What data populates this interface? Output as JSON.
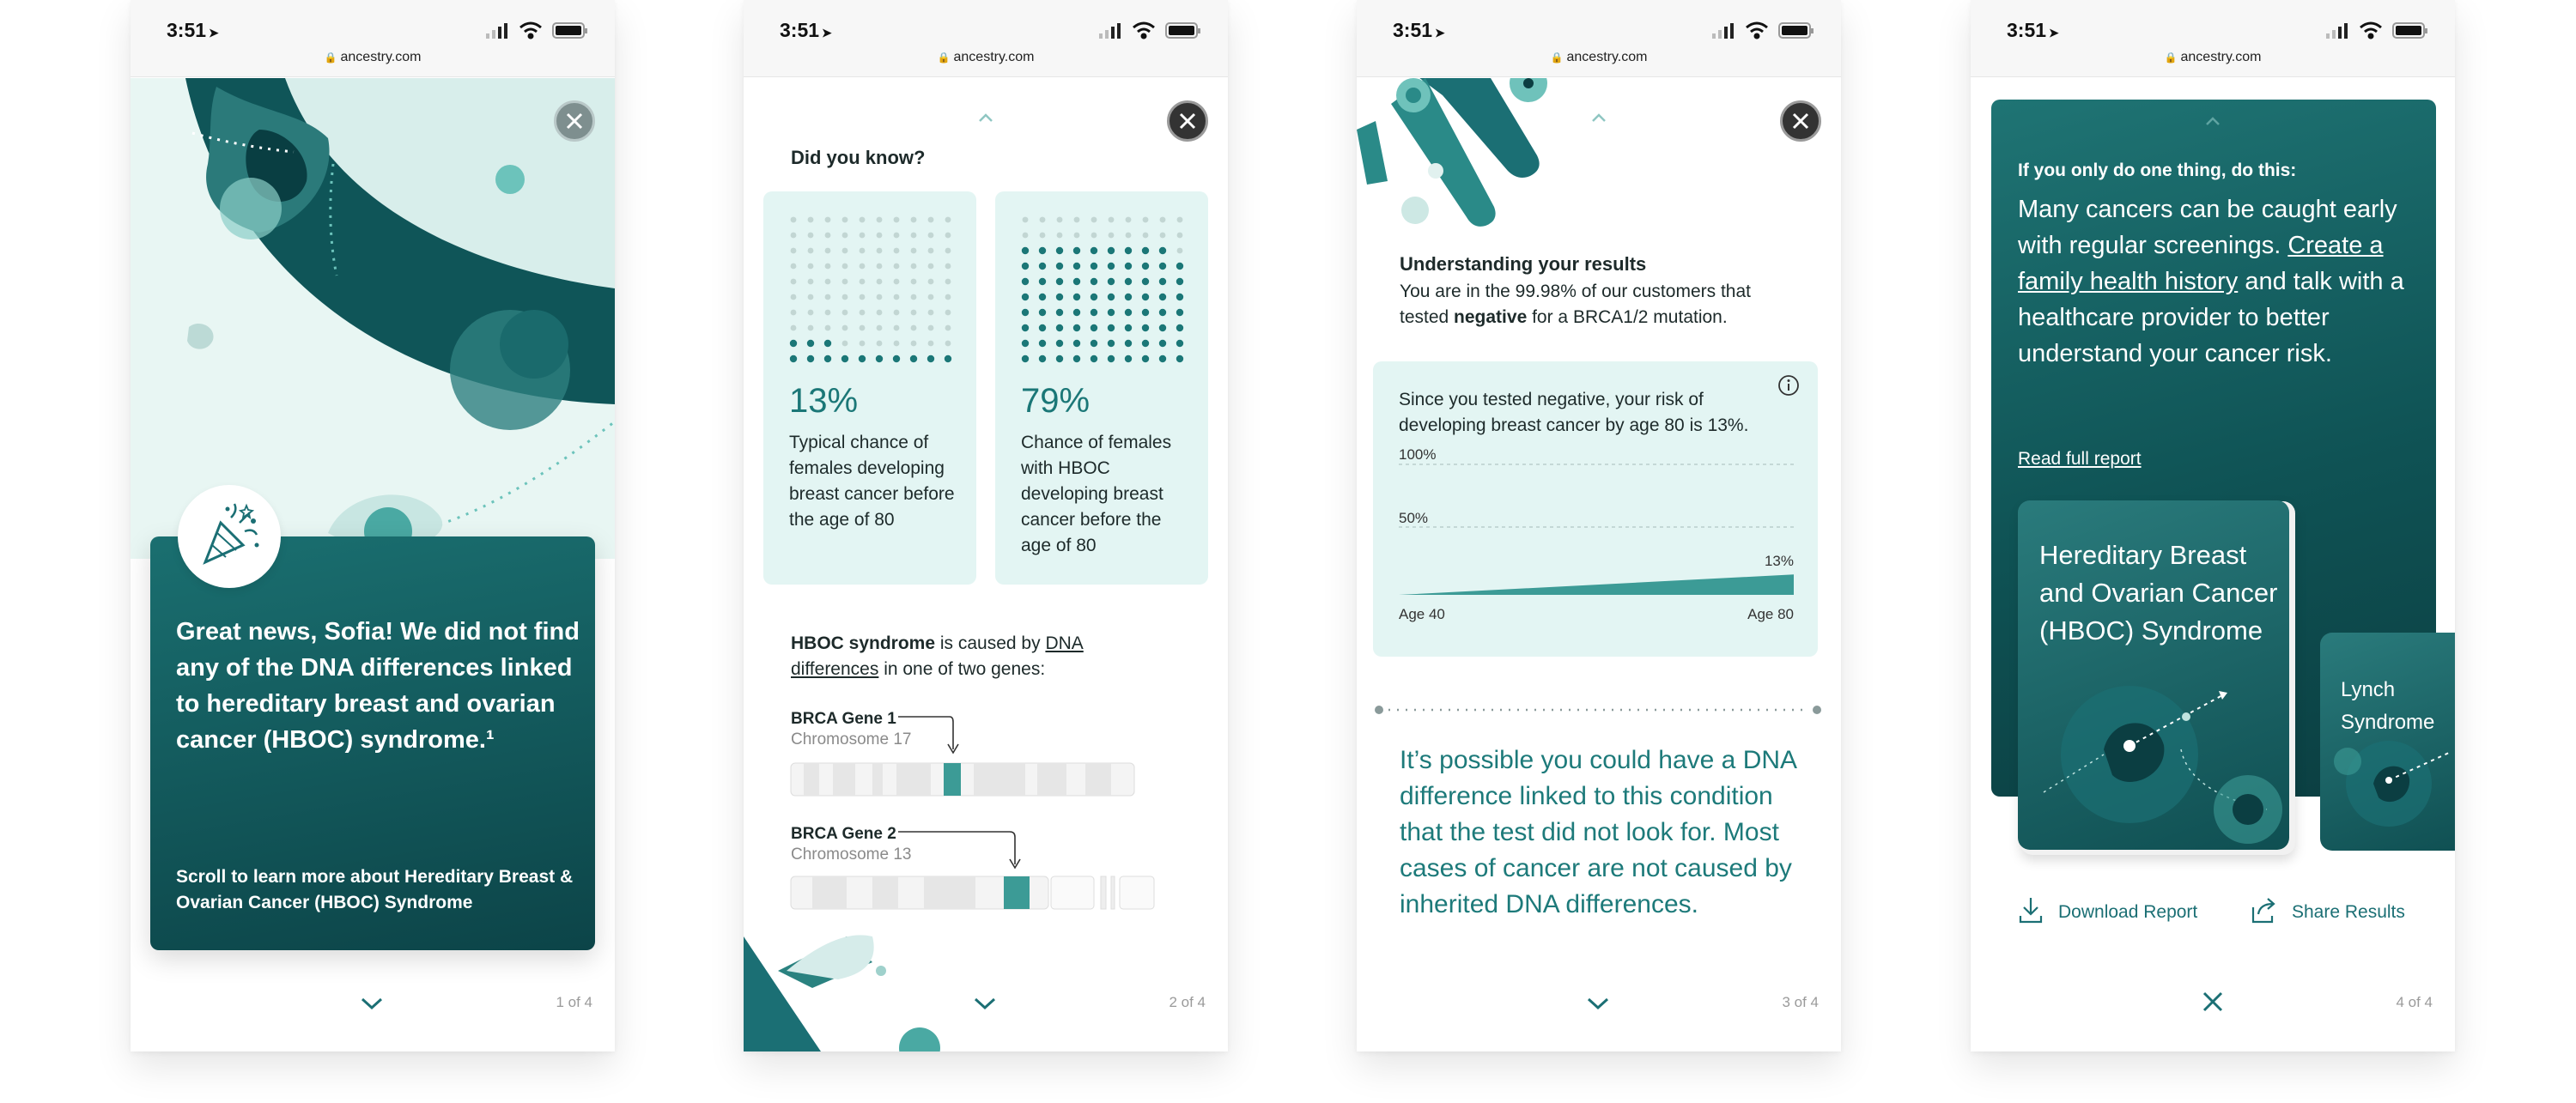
{
  "status": {
    "time": "3:51",
    "url": "ancestry.com"
  },
  "screen1": {
    "headline": "Great news, Sofia! We did not find any of the DNA differences linked to hereditary breast and ovarian cancer (HBOC) syndrome.¹",
    "scroll_hint": "Scroll to learn more about Hereditary Breast & Ovarian Cancer (HBOC) Syndrome",
    "page": "1 of 4"
  },
  "screen2": {
    "title": "Did you know?",
    "stat_left": {
      "percent": "13%",
      "text": "Typical chance of females developing breast cancer before the age of 80",
      "value": 13
    },
    "stat_right": {
      "percent": "79%",
      "text": "Chance of females with HBOC developing breast cancer before the age of 80",
      "value": 79
    },
    "hboc_bold": "HBOC syndrome",
    "hboc_mid": " is caused by ",
    "hboc_link": "DNA differences",
    "hboc_end": " in one of two genes:",
    "gene1_name": "BRCA Gene 1",
    "gene1_chr": "Chromosome 17",
    "gene2_name": "BRCA Gene 2",
    "gene2_chr": "Chromosome 13",
    "page": "2 of 4"
  },
  "screen3": {
    "heading": "Understanding your results",
    "p_before": "You are in the 99.98% of our customers that tested ",
    "p_bold": "negative",
    "p_after": " for a BRCA1/2 mutation.",
    "card_text": "Since you tested negative, your risk of developing breast cancer by age 80 is 13%.",
    "chart": {
      "label_100": "100%",
      "label_50": "50%",
      "value_label": "13%",
      "x_start": "Age 40",
      "x_end": "Age 80"
    },
    "big_text": "It’s possible you could have a DNA difference linked to this condition that the test did not look for. Most cases of cancer are not caused by inherited DNA differences.",
    "page": "3 of 4"
  },
  "screen4": {
    "kicker": "If you only do one thing, do this:",
    "main_before": "Many cancers can be caught early with regular screenings. ",
    "main_link": "Create a family health history",
    "main_after": " and talk with a healthcare provider to better understand your cancer risk.",
    "read_link": "Read full report",
    "report1_title": "Hereditary Breast and Ovarian Cancer (HBOC) Syndrome",
    "report2_title": "Lynch Syndrome",
    "download_label": "Download Report",
    "share_label": "Share Results",
    "page": "4 of 4"
  },
  "colors": {
    "teal_dark": "#0c4448",
    "teal": "#1b7777",
    "mint": "#e3f5f3"
  }
}
